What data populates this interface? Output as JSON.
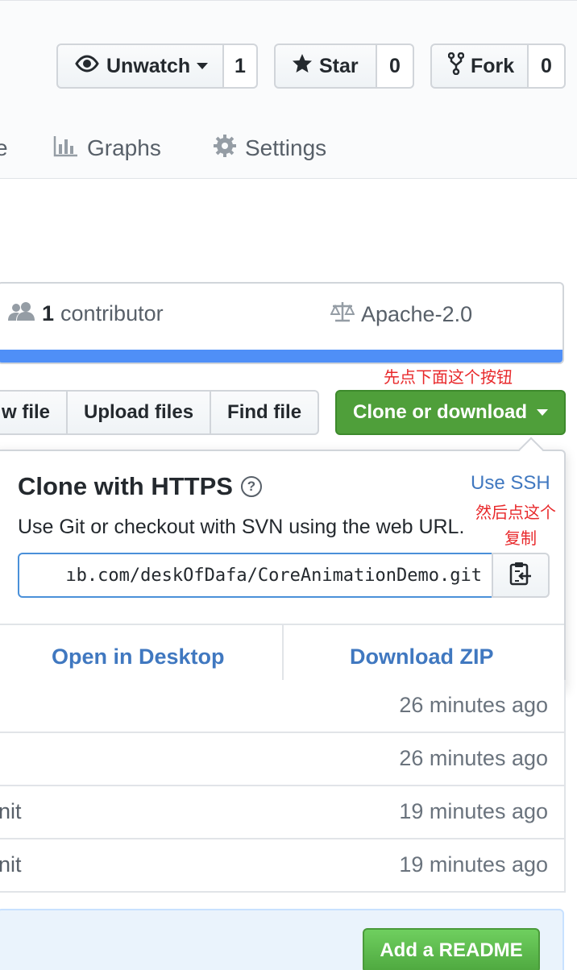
{
  "header": {
    "watch": {
      "label": "Unwatch",
      "count": "1"
    },
    "star": {
      "label": "Star",
      "count": "0"
    },
    "fork": {
      "label": "Fork",
      "count": "0"
    }
  },
  "tabs": {
    "partial_label": "e",
    "graphs": "Graphs",
    "settings": "Settings"
  },
  "summary": {
    "contributors_count": "1",
    "contributors_label": "contributor",
    "license": "Apache-2.0",
    "language_color": "#4f8ff7"
  },
  "file_actions": {
    "new_file": "w file",
    "upload": "Upload files",
    "find": "Find file",
    "clone": "Clone or download",
    "clone_color": "#4f9f3a"
  },
  "annotations": {
    "first": "先点下面这个按钮",
    "second_line1": "然后点这个",
    "second_line2": "复制",
    "color": "#e8292b"
  },
  "clone_popup": {
    "title": "Clone with HTTPS",
    "use_ssh": "Use SSH",
    "description": "Use Git or checkout with SVN using the web URL.",
    "url": "ıb.com/deskOfDafa/CoreAnimationDemo.git",
    "open_desktop": "Open in Desktop",
    "download_zip": "Download ZIP"
  },
  "file_rows": [
    {
      "message": "",
      "time": "26 minutes ago"
    },
    {
      "message": "",
      "time": "26 minutes ago"
    },
    {
      "message": "nit",
      "time": "19 minutes ago"
    },
    {
      "message": "nit",
      "time": "19 minutes ago"
    }
  ],
  "readme": {
    "button": "Add a README"
  }
}
